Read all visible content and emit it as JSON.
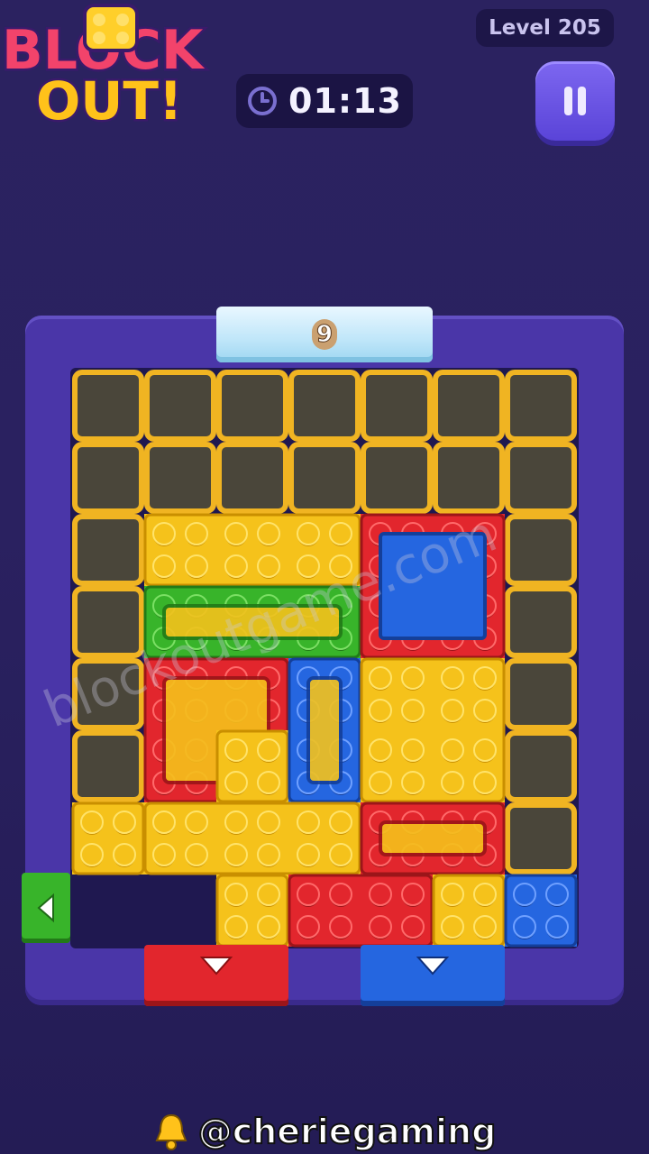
{
  "header": {
    "logo_line1": "BLOCK",
    "logo_line2": "OUT!",
    "timer": "01:13",
    "level_label": "Level 205"
  },
  "board": {
    "ice_counter": "9",
    "cols": 7,
    "rows": 8,
    "empty_cells": [
      [
        0,
        0
      ],
      [
        1,
        0
      ],
      [
        2,
        0
      ],
      [
        3,
        0
      ],
      [
        4,
        0
      ],
      [
        5,
        0
      ],
      [
        6,
        0
      ],
      [
        0,
        1
      ],
      [
        1,
        1
      ],
      [
        2,
        1
      ],
      [
        3,
        1
      ],
      [
        4,
        1
      ],
      [
        5,
        1
      ],
      [
        6,
        1
      ],
      [
        0,
        2
      ],
      [
        6,
        2
      ],
      [
        0,
        3
      ],
      [
        6,
        3
      ],
      [
        0,
        4
      ],
      [
        6,
        4
      ],
      [
        0,
        5
      ],
      [
        6,
        5
      ],
      [
        6,
        6
      ]
    ],
    "blocks": [
      {
        "id": "yellow-bar-top",
        "color": "yellow",
        "cells": [
          [
            1,
            2
          ],
          [
            2,
            2
          ],
          [
            3,
            2
          ]
        ]
      },
      {
        "id": "green-bar",
        "color": "green",
        "hollow": true,
        "cells": [
          [
            1,
            3
          ],
          [
            2,
            3
          ],
          [
            3,
            3
          ]
        ]
      },
      {
        "id": "red-square-blue-center",
        "color": "red",
        "cells": [
          [
            4,
            2
          ],
          [
            5,
            2
          ],
          [
            4,
            3
          ],
          [
            5,
            3
          ]
        ]
      },
      {
        "id": "red-corner",
        "color": "red",
        "hollow": true,
        "cells": [
          [
            1,
            4
          ],
          [
            2,
            4
          ],
          [
            1,
            5
          ]
        ]
      },
      {
        "id": "yellow-l-piece",
        "color": "yellow",
        "cells": [
          [
            2,
            5
          ]
        ]
      },
      {
        "id": "blue-tall",
        "color": "blue",
        "hollow": true,
        "cells": [
          [
            3,
            4
          ],
          [
            3,
            5
          ]
        ]
      },
      {
        "id": "yellow-square-big",
        "color": "yellow",
        "cells": [
          [
            4,
            4
          ],
          [
            5,
            4
          ],
          [
            4,
            5
          ],
          [
            5,
            5
          ]
        ]
      },
      {
        "id": "yellow-single-left",
        "color": "yellow",
        "cells": [
          [
            0,
            6
          ]
        ]
      },
      {
        "id": "yellow-bar-bottom",
        "color": "yellow",
        "cells": [
          [
            1,
            6
          ],
          [
            2,
            6
          ],
          [
            3,
            6
          ]
        ]
      },
      {
        "id": "red-bar-hollow",
        "color": "red",
        "hollow": true,
        "cells": [
          [
            4,
            6
          ],
          [
            5,
            6
          ]
        ]
      },
      {
        "id": "yellow-small-a",
        "color": "yellow",
        "cells": [
          [
            2,
            7
          ]
        ]
      },
      {
        "id": "red-bar-bottom",
        "color": "red",
        "cells": [
          [
            3,
            7
          ],
          [
            4,
            7
          ]
        ]
      },
      {
        "id": "yellow-small-b",
        "color": "yellow",
        "cells": [
          [
            5,
            7
          ]
        ]
      },
      {
        "id": "blue-single",
        "color": "blue",
        "cells": [
          [
            6,
            7
          ]
        ]
      }
    ],
    "exits": [
      {
        "id": "green-left-exit",
        "color": "green",
        "direction": "left"
      },
      {
        "id": "red-bottom-exit",
        "color": "red",
        "direction": "down"
      },
      {
        "id": "blue-bottom-exit",
        "color": "blue",
        "direction": "down"
      }
    ]
  },
  "colors": {
    "yellow": "#f5c21b",
    "red": "#e2262d",
    "green": "#38b42a",
    "blue": "#2566e0",
    "empty_border": "#f0b422",
    "empty_fill": "#4a463a"
  },
  "watermark": "blockoutgame.com",
  "footer": {
    "handle": "@cheriegaming",
    "icon": "bell-icon"
  }
}
